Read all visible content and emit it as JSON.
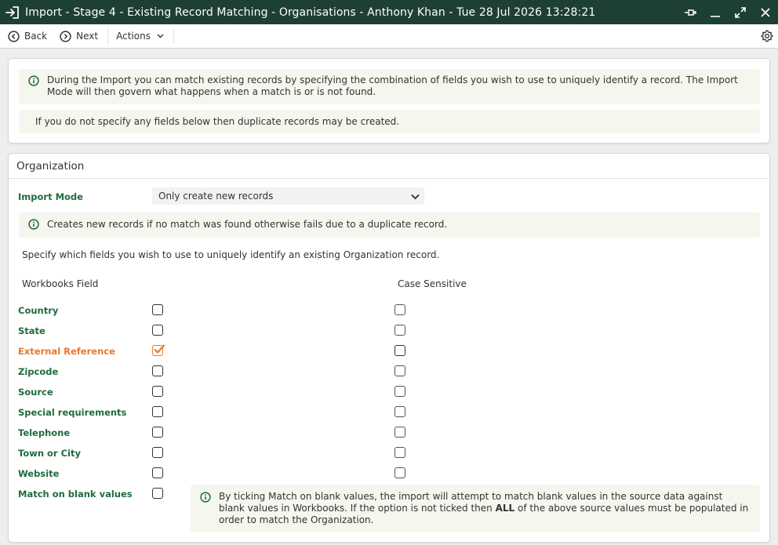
{
  "window": {
    "title": "Import - Stage 4 - Existing Record Matching - Organisations - Anthony Khan - Tue 28 Jul 2026 13:28:21"
  },
  "toolbar": {
    "back_label": "Back",
    "next_label": "Next",
    "actions_label": "Actions"
  },
  "intro": {
    "info_text": "During the Import you can match existing records by specifying the combination of fields you wish to use to uniquely identify a record. The Import Mode will then govern what happens when a match is or is not found.",
    "warning_text": "If you do not specify any fields below then duplicate records may be created."
  },
  "organization": {
    "header": "Organization",
    "import_mode_label": "Import Mode",
    "import_mode_value": "Only create new records",
    "mode_info": "Creates new records if no match was found otherwise fails due to a duplicate record.",
    "specify_text": "Specify which fields you wish to use to uniquely identify an existing Organization record.",
    "col_field": "Workbooks Field",
    "col_case": "Case Sensitive",
    "fields": [
      {
        "label": "Country",
        "checked": false,
        "case_sensitive": false
      },
      {
        "label": "State",
        "checked": false,
        "case_sensitive": false
      },
      {
        "label": "External Reference",
        "checked": true,
        "case_sensitive": false
      },
      {
        "label": "Zipcode",
        "checked": false,
        "case_sensitive": false
      },
      {
        "label": "Source",
        "checked": false,
        "case_sensitive": false
      },
      {
        "label": "Special requirements",
        "checked": false,
        "case_sensitive": false
      },
      {
        "label": "Telephone",
        "checked": false,
        "case_sensitive": false
      },
      {
        "label": "Town or City",
        "checked": false,
        "case_sensitive": false
      },
      {
        "label": "Website",
        "checked": false,
        "case_sensitive": false
      }
    ],
    "blank_label": "Match on blank values",
    "blank_checked": false,
    "blank_info_part1": "By ticking Match on blank values, the import will attempt to match blank values in the source data against blank values in Workbooks. If the option is not ticked then ",
    "blank_info_bold": "ALL",
    "blank_info_part2": " of the above source values must be populated in order to match the Organization."
  },
  "colors": {
    "titlebar": "#1e3f36",
    "label_green": "#1f6b3f",
    "label_active": "#e8782a",
    "info_bg": "#f5f6ee",
    "info_icon": "#1f6b3f"
  }
}
